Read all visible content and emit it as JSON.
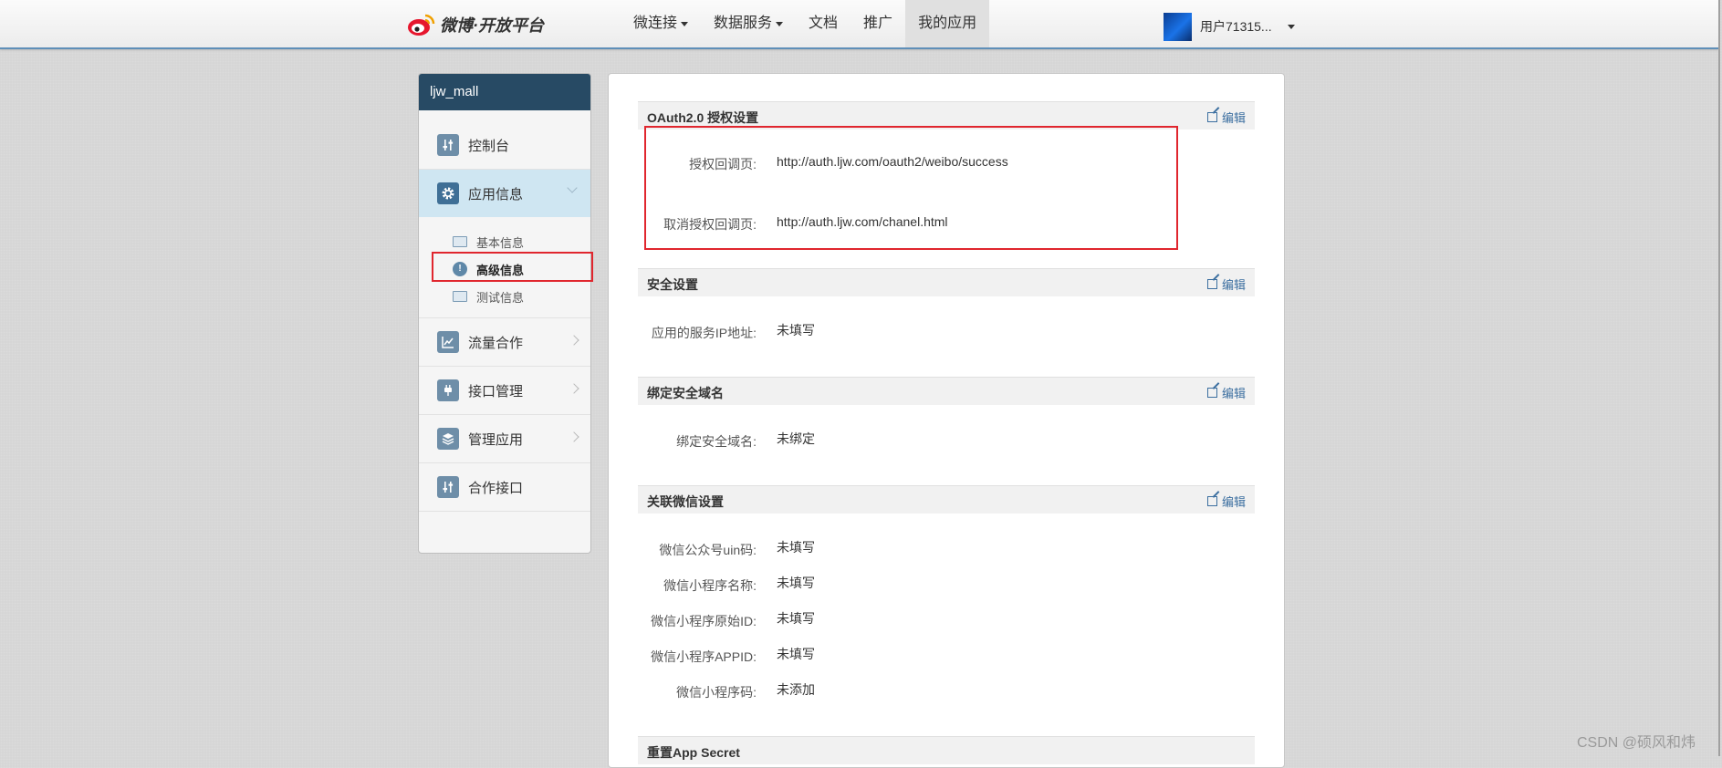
{
  "header": {
    "logo_text": "微博·开放平台",
    "nav": [
      {
        "label": "微连接",
        "dropdown": true
      },
      {
        "label": "数据服务",
        "dropdown": true
      },
      {
        "label": "文档",
        "dropdown": false
      },
      {
        "label": "推广",
        "dropdown": false
      },
      {
        "label": "我的应用",
        "dropdown": false,
        "active": true
      }
    ],
    "user_name": "用户71315..."
  },
  "sidebar": {
    "app_name": "ljw_mall",
    "items": [
      {
        "label": "控制台",
        "icon": "sliders-icon"
      },
      {
        "label": "应用信息",
        "icon": "gear-icon",
        "active": true
      },
      {
        "label": "流量合作",
        "icon": "chart-icon"
      },
      {
        "label": "接口管理",
        "icon": "plug-icon"
      },
      {
        "label": "管理应用",
        "icon": "layers-icon"
      },
      {
        "label": "合作接口",
        "icon": "sliders-icon"
      }
    ],
    "subitems": [
      {
        "label": "基本信息",
        "icon": "id-card-icon"
      },
      {
        "label": "高级信息",
        "icon": "info-icon",
        "current": true
      },
      {
        "label": "测试信息",
        "icon": "user-card-icon"
      }
    ]
  },
  "main": {
    "edit_label": "编辑",
    "oauth": {
      "title": "OAuth2.0 授权设置",
      "rows": [
        {
          "label": "授权回调页:",
          "value": "http://auth.ljw.com/oauth2/weibo/success"
        },
        {
          "label": "取消授权回调页:",
          "value": "http://auth.ljw.com/chanel.html"
        }
      ]
    },
    "security": {
      "title": "安全设置",
      "rows": [
        {
          "label": "应用的服务IP地址:",
          "value": "未填写"
        }
      ]
    },
    "domain": {
      "title": "绑定安全域名",
      "rows": [
        {
          "label": "绑定安全域名:",
          "value": "未绑定"
        }
      ]
    },
    "wechat": {
      "title": "关联微信设置",
      "rows": [
        {
          "label": "微信公众号uin码:",
          "value": "未填写"
        },
        {
          "label": "微信小程序名称:",
          "value": "未填写"
        },
        {
          "label": "微信小程序原始ID:",
          "value": "未填写"
        },
        {
          "label": "微信小程序APPID:",
          "value": "未填写"
        },
        {
          "label": "微信小程序码:",
          "value": "未添加"
        }
      ]
    },
    "reset": {
      "title": "重置App Secret"
    }
  },
  "watermark": "CSDN @硕风和炜",
  "colors": {
    "sidebar_header": "#274a64",
    "highlight_box": "#e0262e",
    "active_item": "#cfe6f2",
    "link": "#3c6fa0"
  }
}
